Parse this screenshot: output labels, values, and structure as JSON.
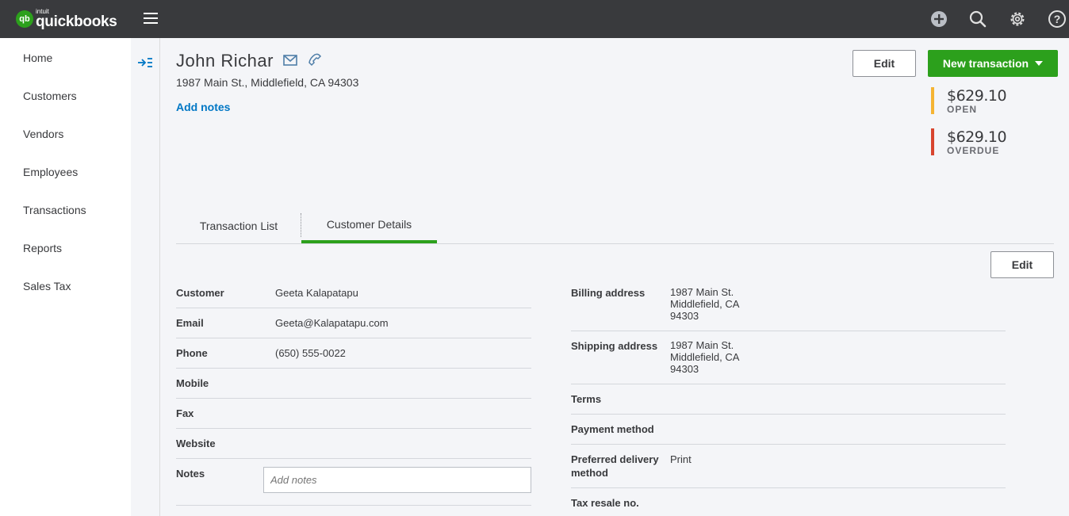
{
  "app": {
    "logo_mark": "qb",
    "logo_small": "intuit",
    "logo_name": "quickbooks"
  },
  "sidebar": {
    "items": [
      {
        "label": "Home"
      },
      {
        "label": "Customers"
      },
      {
        "label": "Vendors"
      },
      {
        "label": "Employees"
      },
      {
        "label": "Transactions"
      },
      {
        "label": "Reports"
      },
      {
        "label": "Sales Tax"
      }
    ]
  },
  "header": {
    "customer_name": "John Richar",
    "address": "1987 Main St., Middlefield, CA 94303",
    "add_notes": "Add notes",
    "edit_label": "Edit",
    "new_transaction_label": "New transaction"
  },
  "summary": {
    "open_amount": "$629.10",
    "open_label": "OPEN",
    "overdue_amount": "$629.10",
    "overdue_label": "OVERDUE",
    "open_color": "#f5b433",
    "overdue_color": "#d8452f"
  },
  "tabs": [
    {
      "label": "Transaction List"
    },
    {
      "label": "Customer Details"
    }
  ],
  "details": {
    "edit_label": "Edit",
    "left": [
      {
        "label": "Customer",
        "value": "Geeta Kalapatapu"
      },
      {
        "label": "Email",
        "value": "Geeta@Kalapatapu.com"
      },
      {
        "label": "Phone",
        "value": "(650) 555-0022"
      },
      {
        "label": "Mobile",
        "value": ""
      },
      {
        "label": "Fax",
        "value": ""
      },
      {
        "label": "Website",
        "value": ""
      },
      {
        "label": "Notes",
        "placeholder": "Add notes"
      }
    ],
    "right": [
      {
        "label": "Billing address",
        "lines": [
          "1987 Main St.",
          "Middlefield, CA",
          "94303"
        ]
      },
      {
        "label": "Shipping address",
        "lines": [
          "1987 Main St.",
          "Middlefield, CA",
          "94303"
        ]
      },
      {
        "label": "Terms",
        "value": ""
      },
      {
        "label": "Payment method",
        "value": ""
      },
      {
        "label_lines": [
          "Preferred delivery",
          "method"
        ],
        "value": "Print"
      },
      {
        "label": "Tax resale no.",
        "value": ""
      }
    ]
  }
}
